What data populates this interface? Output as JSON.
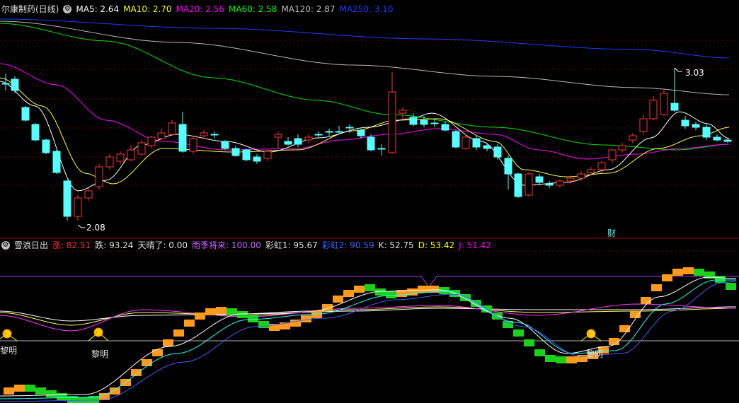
{
  "main": {
    "title": "尔康制药(日线)",
    "ma": [
      {
        "label": "MA5: 2.64",
        "color": "#ffffff"
      },
      {
        "label": "MA10: 2.70",
        "color": "#ffff00"
      },
      {
        "label": "MA20: 2.56",
        "color": "#ff00ff"
      },
      {
        "label": "MA60: 2.58",
        "color": "#00ff00"
      },
      {
        "label": "MA120: 2.87",
        "color": "#c0c0c0"
      },
      {
        "label": "MA250: 3.10",
        "color": "#1e3cff"
      }
    ],
    "high_label": "3.03",
    "low_label": "2.08",
    "finance_marker": "财"
  },
  "sub": {
    "title": "雪浪日出",
    "indicators": [
      {
        "label": "涨: 82.51",
        "color": "#ff3030"
      },
      {
        "label": "跌: 93.24",
        "color": "#e0e0e0"
      },
      {
        "label": "天晴了: 0.00",
        "color": "#e0e0e0"
      },
      {
        "label": "雨季将来: 100.00",
        "color": "#cc66ff"
      },
      {
        "label": "彩虹1: 95.67",
        "color": "#e0e0e0"
      },
      {
        "label": "彩虹2: 90.59",
        "color": "#4060ff"
      },
      {
        "label": "K: 52.75",
        "color": "#e0e0e0"
      },
      {
        "label": "D: 53.42",
        "color": "#ffff00"
      },
      {
        "label": "J: 51.42",
        "color": "#ff00ff"
      }
    ],
    "dawn_label": "黎明"
  },
  "colors": {
    "up": "#ff3333",
    "down": "#54ffff",
    "grid": "#800000",
    "separator": "#a00000",
    "orange": "#ff9a1a",
    "green": "#19d219"
  }
}
